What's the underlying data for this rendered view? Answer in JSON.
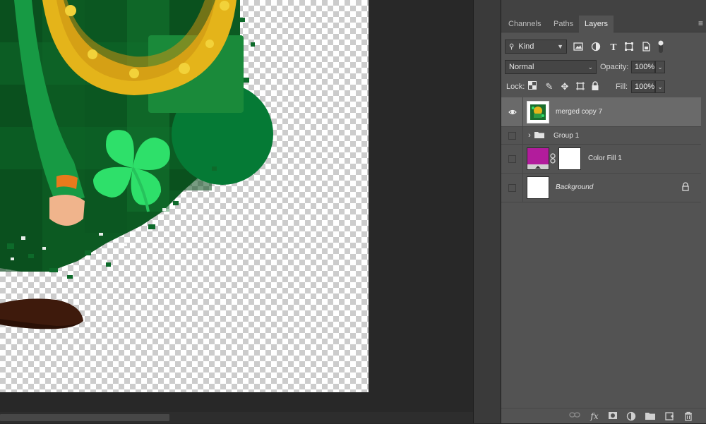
{
  "tabs": [
    {
      "label": "Channels"
    },
    {
      "label": "Paths"
    },
    {
      "label": "Layers",
      "active": true
    }
  ],
  "filter": {
    "kind_label": "Kind",
    "icons": [
      "pixel-filter-icon",
      "adjustment-filter-icon",
      "type-filter-icon",
      "shape-filter-icon",
      "smart-object-filter-icon",
      "filter-toggle-icon"
    ]
  },
  "blend": {
    "mode": "Normal",
    "opacity_label": "Opacity:",
    "opacity_value": "100%"
  },
  "lock": {
    "label": "Lock:",
    "icons": [
      "lock-transparent-pixels-icon",
      "lock-image-pixels-icon",
      "lock-position-icon",
      "artboard-lock-icon",
      "lock-all-icon"
    ],
    "fill_label": "Fill:",
    "fill_value": "100%"
  },
  "layers": [
    {
      "name": "merged copy 7",
      "visible": true,
      "selected": true,
      "type": "pixel"
    },
    {
      "name": "Group 1",
      "visible": false,
      "type": "group"
    },
    {
      "name": "Color Fill 1",
      "visible": false,
      "type": "fill",
      "fill_color": "#b21c9c"
    },
    {
      "name": "Background",
      "visible": false,
      "type": "background",
      "locked": true
    }
  ],
  "bottom_icons": [
    "link-layers-icon",
    "fx-icon",
    "add-mask-icon",
    "new-adjustment-icon",
    "new-group-icon",
    "new-layer-icon",
    "delete-layer-icon"
  ],
  "bottom_fx_label": "fx",
  "colors": {
    "canvas_green_dark": "#0e4a1f",
    "canvas_green": "#057a35",
    "clover": "#2ee06a",
    "horseshoe": "#e4b41a",
    "shoe": "#3e1a0c"
  }
}
